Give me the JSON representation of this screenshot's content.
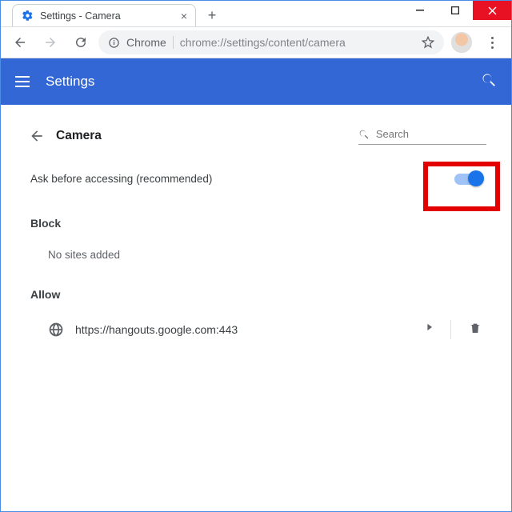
{
  "window": {
    "tab_title": "Settings - Camera"
  },
  "toolbar": {
    "chrome_label": "Chrome",
    "url": "chrome://settings/content/camera"
  },
  "settings_header": {
    "title": "Settings"
  },
  "page": {
    "title": "Camera",
    "search_placeholder": "Search",
    "ask_label": "Ask before accessing (recommended)",
    "ask_toggle": true,
    "block_label": "Block",
    "block_empty": "No sites added",
    "allow_label": "Allow",
    "allow_sites": [
      {
        "url": "https://hangouts.google.com:443"
      }
    ]
  }
}
